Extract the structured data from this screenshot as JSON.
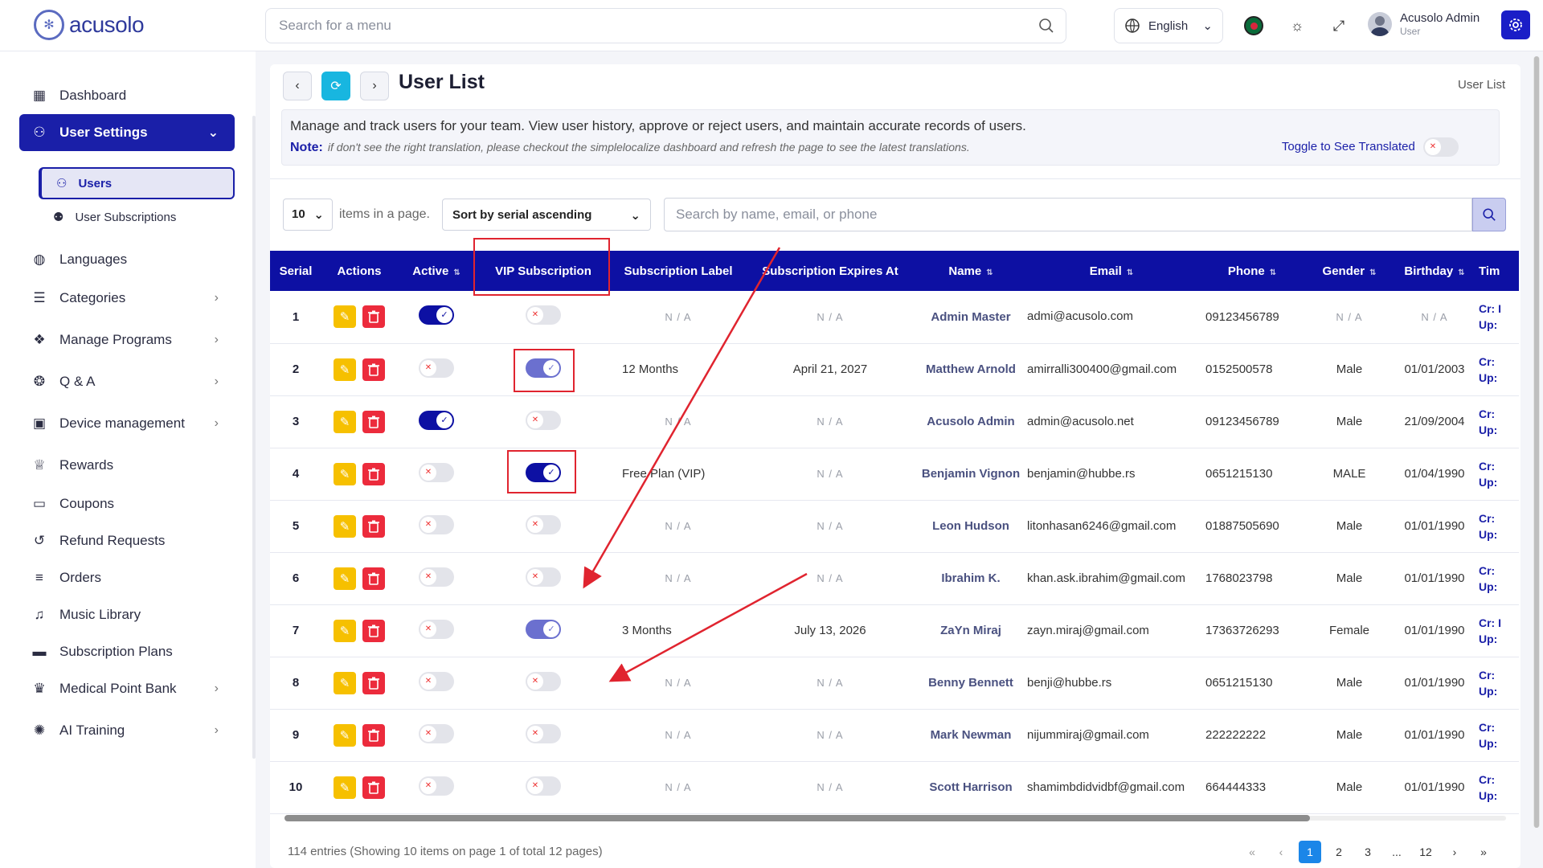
{
  "brand": {
    "name": "acusolo"
  },
  "topbar": {
    "search_placeholder": "Search for a menu",
    "language": "English",
    "user_name": "Acusolo Admin",
    "user_role": "User"
  },
  "sidebar": {
    "items": [
      {
        "label": "Dashboard",
        "icon": "grid-icon"
      },
      {
        "label": "User Settings",
        "icon": "users-gear-icon",
        "active": true
      },
      {
        "label": "Languages",
        "icon": "globe-icon"
      },
      {
        "label": "Categories",
        "icon": "list-icon"
      },
      {
        "label": "Manage Programs",
        "icon": "programs-icon"
      },
      {
        "label": "Q & A",
        "icon": "help-icon"
      },
      {
        "label": "Device management",
        "icon": "devices-icon"
      },
      {
        "label": "Rewards",
        "icon": "trophy-icon"
      },
      {
        "label": "Coupons",
        "icon": "ticket-icon"
      },
      {
        "label": "Refund Requests",
        "icon": "refund-icon"
      },
      {
        "label": "Orders",
        "icon": "orders-icon"
      },
      {
        "label": "Music Library",
        "icon": "music-icon"
      },
      {
        "label": "Subscription Plans",
        "icon": "card-icon"
      },
      {
        "label": "Medical Point Bank",
        "icon": "medal-icon"
      },
      {
        "label": "AI Training",
        "icon": "ai-icon"
      }
    ],
    "sub_items": [
      {
        "label": "Users",
        "active": true
      },
      {
        "label": "User Subscriptions"
      }
    ]
  },
  "page": {
    "title": "User List",
    "breadcrumb": "User List",
    "description": "Manage and track users for your team. View user history, approve or reject users, and maintain accurate records of users.",
    "note_label": "Note:",
    "note_text": "if don't see the right translation, please checkout the simplelocalize dashboard and refresh the page to see the latest translations.",
    "toggle_translated_label": "Toggle to See Translated"
  },
  "controls": {
    "page_size": "10",
    "items_label": "items in a page.",
    "sort": "Sort by serial ascending",
    "search_placeholder": "Search by name, email, or phone"
  },
  "table": {
    "headers": [
      "Serial",
      "Actions",
      "Active",
      "VIP Subscription",
      "Subscription Label",
      "Subscription Expires At",
      "Name",
      "Email",
      "Phone",
      "Gender",
      "Birthday",
      "Tim"
    ],
    "rows": [
      {
        "serial": "1",
        "active": true,
        "vip": false,
        "label": "N / A",
        "expires": "N / A",
        "name": "Admin Master",
        "email": "admi@acusolo.com",
        "phone": "09123456789",
        "gender": "N / A",
        "birthday": "N / A",
        "cr": "Cr: I",
        "up": "Up:"
      },
      {
        "serial": "2",
        "active": false,
        "vip": true,
        "label": "12 Months",
        "expires": "April 21, 2027",
        "name": "Matthew Arnold",
        "email": "amirralli300400@gmail.com",
        "phone": "0152500578",
        "gender": "Male",
        "birthday": "01/01/2003",
        "cr": "Cr: ",
        "up": "Up:"
      },
      {
        "serial": "3",
        "active": true,
        "vip": false,
        "label": "N / A",
        "expires": "N / A",
        "name": "Acusolo Admin",
        "email": "admin@acusolo.net",
        "phone": "09123456789",
        "gender": "Male",
        "birthday": "21/09/2004",
        "cr": "Cr: ",
        "up": "Up:"
      },
      {
        "serial": "4",
        "active": false,
        "vip": true,
        "label": "Free Plan (VIP)",
        "expires": "N / A",
        "name": "Benjamin Vignon",
        "email": "benjamin@hubbe.rs",
        "phone": "0651215130",
        "gender": "MALE",
        "birthday": "01/04/1990",
        "cr": "Cr: ",
        "up": "Up:"
      },
      {
        "serial": "5",
        "active": false,
        "vip": false,
        "label": "N / A",
        "expires": "N / A",
        "name": "Leon Hudson",
        "email": "litonhasan6246@gmail.com",
        "phone": "01887505690",
        "gender": "Male",
        "birthday": "01/01/1990",
        "cr": "Cr: ",
        "up": "Up:"
      },
      {
        "serial": "6",
        "active": false,
        "vip": false,
        "label": "N / A",
        "expires": "N / A",
        "name": "Ibrahim K.",
        "email": "khan.ask.ibrahim@gmail.com",
        "phone": "1768023798",
        "gender": "Male",
        "birthday": "01/01/1990",
        "cr": "Cr: ",
        "up": "Up:"
      },
      {
        "serial": "7",
        "active": false,
        "vip": true,
        "label": "3 Months",
        "expires": "July 13, 2026",
        "name": "ZaYn Miraj",
        "email": "zayn.miraj@gmail.com",
        "phone": "17363726293",
        "gender": "Female",
        "birthday": "01/01/1990",
        "cr": "Cr: I",
        "up": "Up:"
      },
      {
        "serial": "8",
        "active": false,
        "vip": false,
        "label": "N / A",
        "expires": "N / A",
        "name": "Benny Bennett",
        "email": "benji@hubbe.rs",
        "phone": "0651215130",
        "gender": "Male",
        "birthday": "01/01/1990",
        "cr": "Cr: ",
        "up": "Up:"
      },
      {
        "serial": "9",
        "active": false,
        "vip": false,
        "label": "N / A",
        "expires": "N / A",
        "name": "Mark Newman",
        "email": "nijummiraj@gmail.com",
        "phone": "222222222",
        "gender": "Male",
        "birthday": "01/01/1990",
        "cr": "Cr: ",
        "up": "Up:"
      },
      {
        "serial": "10",
        "active": false,
        "vip": false,
        "label": "N / A",
        "expires": "N / A",
        "name": "Scott Harrison",
        "email": "shamimbdidvidbf@gmail.com",
        "phone": "664444333",
        "gender": "Male",
        "birthday": "01/01/1990",
        "cr": "Cr: ",
        "up": "Up:"
      }
    ]
  },
  "footer": {
    "summary": "114 entries (Showing 10 items on page 1 of total 12 pages)",
    "pages": [
      "1",
      "2",
      "3",
      "...",
      "12"
    ],
    "current_page": "1"
  },
  "colors": {
    "primary": "#0d10a3",
    "accent": "#18b6e0",
    "edit": "#f6c000",
    "delete": "#ec2b3c",
    "annotation": "#e0242f"
  }
}
